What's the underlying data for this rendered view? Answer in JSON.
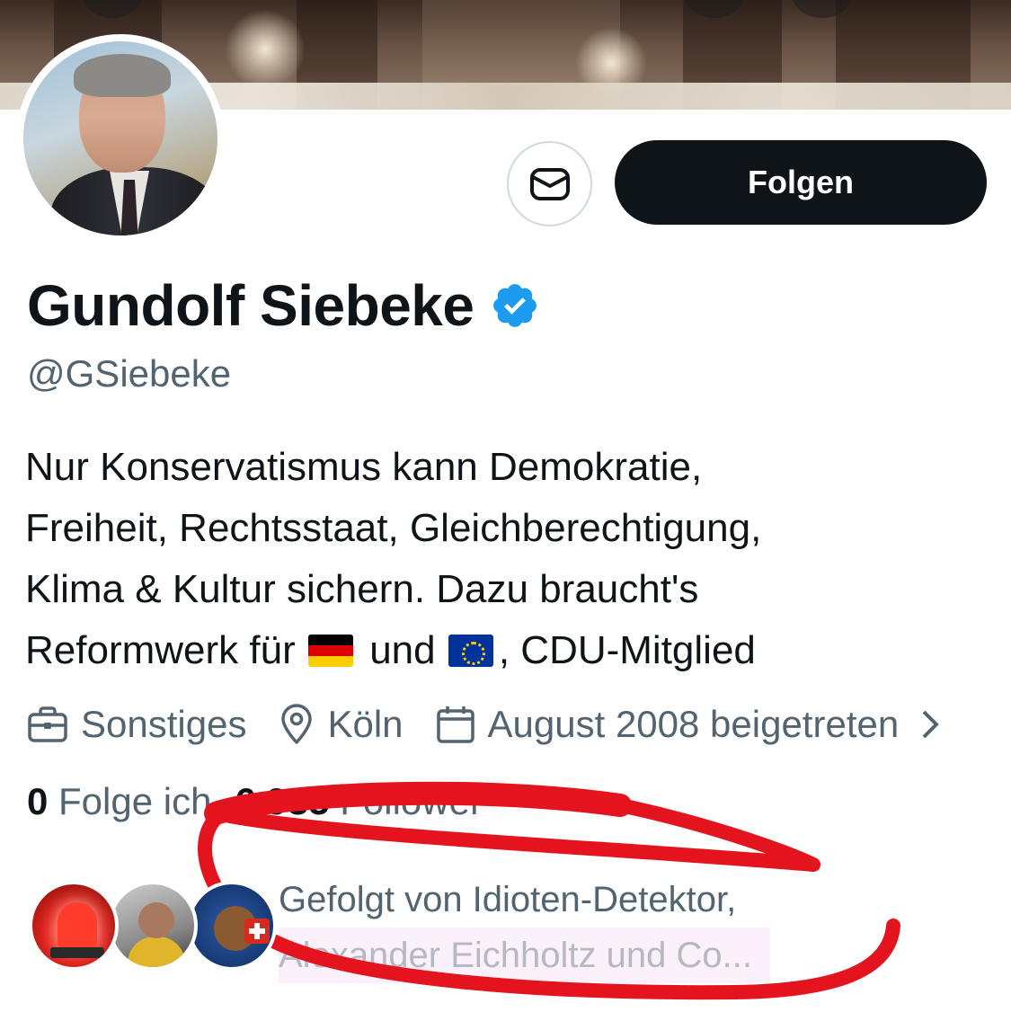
{
  "profile": {
    "name": "Gundolf Siebeke",
    "handle": "@GSiebeke",
    "verified": true,
    "verified_color": "#1d9bf0",
    "bio_lines": [
      "Nur Konservatismus kann Demokratie,",
      "Freiheit, Rechtsstaat, Gleichberechtigung,",
      "Klima & Kultur sichern. Dazu braucht's"
    ],
    "bio_last": {
      "part1": "Reformwerk für",
      "part2": "und",
      "part3": ", CDU-Mitglied"
    },
    "flags": [
      "german-flag-icon",
      "eu-flag-icon"
    ]
  },
  "actions": {
    "message_icon": "envelope-icon",
    "follow_label": "Folgen"
  },
  "meta": {
    "category": "Sonstiges",
    "location": "Köln",
    "joined": "August 2008 beigetreten"
  },
  "counts": {
    "following_value": "0",
    "following_label": "Folge ich",
    "followers_value": "6.935",
    "followers_label": "Follower"
  },
  "followed_by": {
    "line1": "Gefolgt von Idioten-Detektor,",
    "line2": "Alexander Eichholtz und Co..."
  },
  "colors": {
    "primary_text": "#0f1419",
    "secondary_text": "#536471",
    "button_dark": "#0f1419",
    "annotation_red": "#e3141d"
  }
}
